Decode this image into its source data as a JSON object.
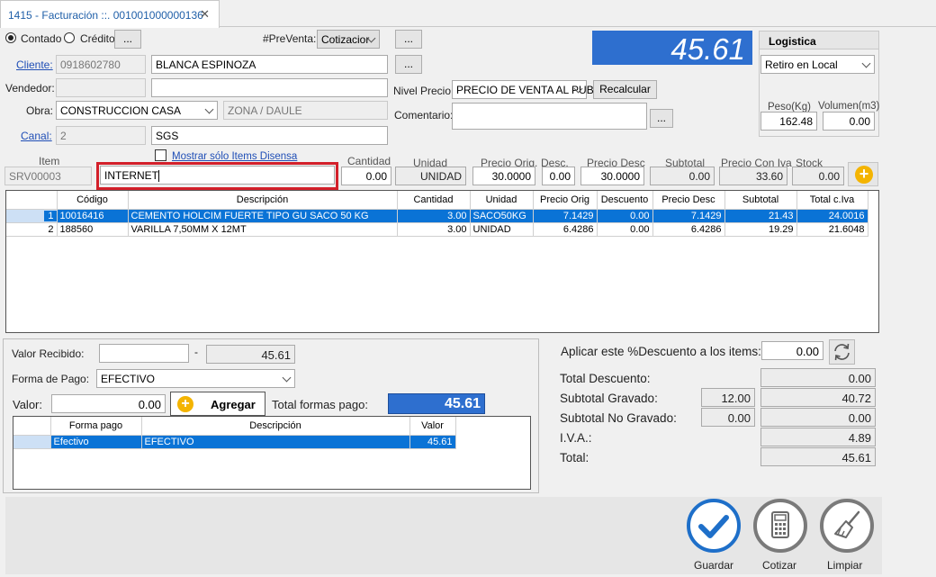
{
  "tab": {
    "title": "1415 - Facturación ::. 001001000000136",
    "close": "✕"
  },
  "payment_type": {
    "contado": "Contado",
    "credito": "Crédito",
    "more": "..."
  },
  "preventa": {
    "label": "#PreVenta:",
    "value": "Cotizacior",
    "more": "..."
  },
  "total_display": "45.61",
  "logistica": {
    "title": "Logistica",
    "option": "Retiro en Local",
    "peso_label": "Peso(Kg)",
    "volumen_label": "Volumen(m3)",
    "peso": "162.48",
    "volumen": "0.00"
  },
  "cliente": {
    "label": "Cliente:",
    "id": "0918602780",
    "name": "BLANCA ESPINOZA",
    "more": "..."
  },
  "vendedor": {
    "label": "Vendedor:",
    "id": "",
    "name": ""
  },
  "nivel_precio": {
    "label": "Nivel Precio:",
    "value": "PRECIO DE VENTA AL PUB",
    "recalcular": "Recalcular"
  },
  "obra": {
    "label": "Obra:",
    "value": "CONSTRUCCION CASA",
    "zona": "ZONA / DAULE"
  },
  "comentario": {
    "label": "Comentario:",
    "value": "",
    "more": "..."
  },
  "canal": {
    "label": "Canal:",
    "id": "2",
    "name": "SGS"
  },
  "mostrar": "Mostrar sólo Items Disensa",
  "entry": {
    "h_item": "Item",
    "h_cantidad": "Cantidad",
    "h_unidad": "Unidad",
    "h_precio_orig": "Precio Orig.",
    "h_desc": "Desc.",
    "h_precio_desc": "Precio Desc",
    "h_subtotal": "Subtotal",
    "h_precio_iva": "Precio Con Iva",
    "h_stock": "Stock",
    "code": "SRV00003",
    "description": "INTERNET",
    "cantidad": "0.00",
    "unidad": "UNIDAD",
    "precio_orig": "30.0000",
    "desc": "0.00",
    "precio_desc": "30.0000",
    "subtotal": "0.00",
    "precio_iva": "33.60",
    "stock": "0.00"
  },
  "items_table": {
    "headers": [
      "Código",
      "Descripción",
      "Cantidad",
      "Unidad",
      "Precio Orig",
      "Descuento",
      "Precio Desc",
      "Subtotal",
      "Total c.Iva"
    ],
    "rows": [
      [
        "1",
        "10016416",
        "CEMENTO HOLCIM FUERTE TIPO GU SACO 50 KG",
        "3.00",
        "SACO50KG",
        "7.1429",
        "0.00",
        "7.1429",
        "21.43",
        "24.0016"
      ],
      [
        "2",
        "188560",
        "VARILLA 7,50MM X 12MT",
        "3.00",
        "UNIDAD",
        "6.4286",
        "0.00",
        "6.4286",
        "19.29",
        "21.6048"
      ]
    ]
  },
  "payment": {
    "valor_recibido_label": "Valor Recibido:",
    "valor_recibido": "",
    "dash": "-",
    "recibido_total": "45.61",
    "forma_label": "Forma de Pago:",
    "forma_value": "EFECTIVO",
    "valor_label": "Valor:",
    "valor": "0.00",
    "agregar": "Agregar",
    "total_formas_label": "Total formas pago:",
    "total_formas": "45.61",
    "table_headers": [
      "Forma pago",
      "Descripción",
      "Valor"
    ],
    "table_rows": [
      [
        "Efectivo",
        "EFECTIVO",
        "45.61"
      ]
    ]
  },
  "totals": {
    "aplicar_label": "Aplicar este %Descuento a los items:",
    "aplicar": "0.00",
    "total_descuento_label": "Total Descuento:",
    "total_descuento": "0.00",
    "subtotal_gravado_label": "Subtotal Gravado:",
    "subtotal_gravado_pct": "12.00",
    "subtotal_gravado": "40.72",
    "subtotal_no_gravado_label": "Subtotal No Gravado:",
    "subtotal_no_gravado_pct": "0.00",
    "subtotal_no_gravado": "0.00",
    "iva_label": "I.V.A.:",
    "iva": "4.89",
    "total_label": "Total:",
    "total": "45.61"
  },
  "actions": {
    "guardar": "Guardar",
    "cotizar": "Cotizar",
    "limpiar": "Limpiar"
  },
  "colors": {
    "accent": "#2e6fcf",
    "selection": "#0a73d6",
    "highlight_border": "#d3202a",
    "add_button": "#f4b400"
  }
}
